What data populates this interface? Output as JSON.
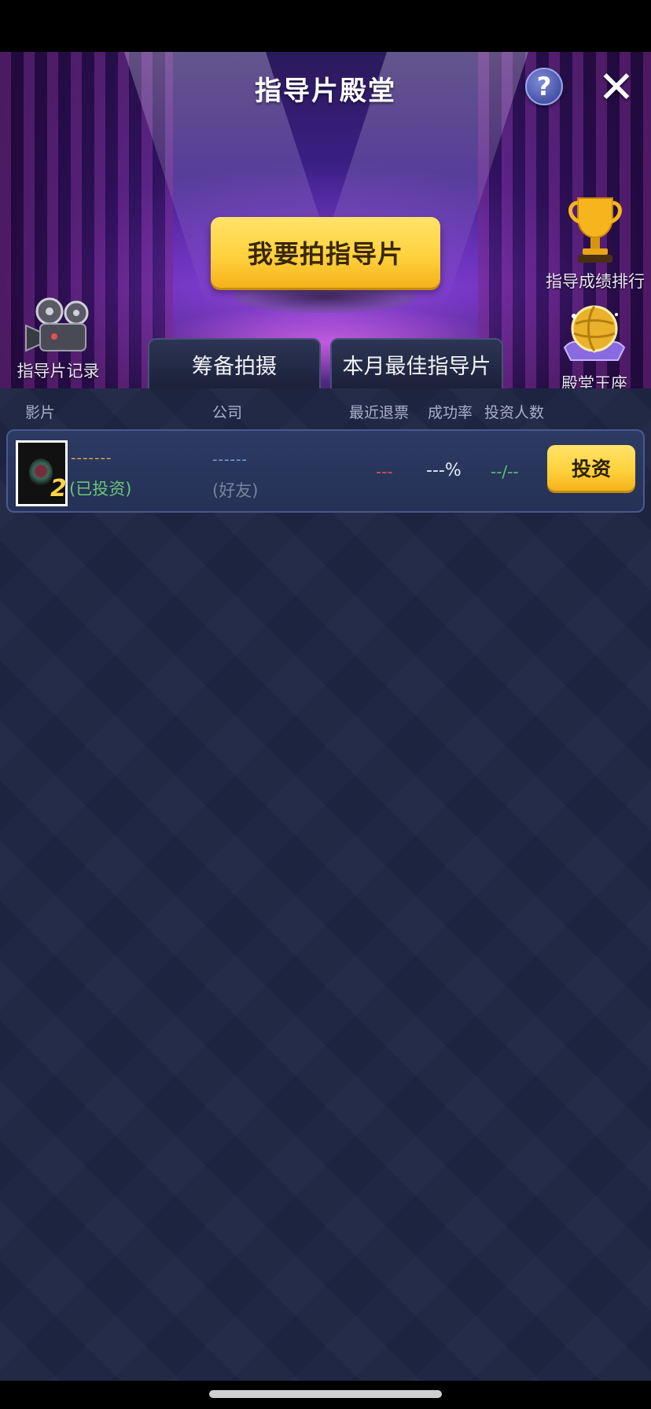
{
  "header": {
    "title": "指导片殿堂",
    "help_icon": "question-mark-icon",
    "help_symbol": "?",
    "close_icon": "close-x-icon",
    "close_symbol": "✕"
  },
  "actions": {
    "shoot_label": "我要拍指导片"
  },
  "side_widgets": {
    "records_label": "指导片记录",
    "records_icon": "film-camera-icon",
    "ranking_label": "指导成绩排行",
    "ranking_icon": "trophy-icon",
    "throne_label": "殿堂王座",
    "throne_icon": "golden-globe-icon"
  },
  "tabs": [
    {
      "label": "筹备拍摄",
      "active": true
    },
    {
      "label": "本月最佳指导片",
      "active": false
    }
  ],
  "table": {
    "columns": [
      "影片",
      "公司",
      "最近退票",
      "成功率",
      "投资人数"
    ],
    "rows": [
      {
        "rank": "2",
        "film_name": "-------",
        "status": "(已投资)",
        "company": "------",
        "company_tag": "(好友)",
        "recent_refund": "---",
        "success_rate": "---%",
        "investors": "--/--",
        "action_label": "投资"
      }
    ]
  },
  "colors": {
    "accent_gold": "#ffd23d",
    "bg_dark": "#1f2745",
    "status_green": "#66c878",
    "refund_red": "#e0524b"
  }
}
